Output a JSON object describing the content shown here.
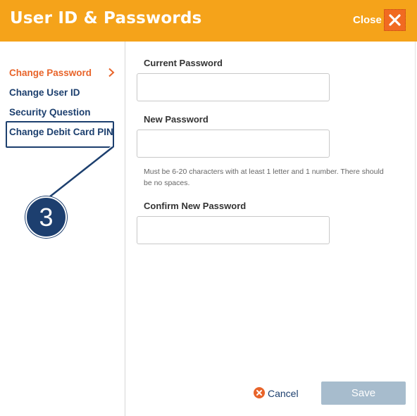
{
  "header": {
    "title": "User ID & Passwords",
    "close_label": "Close",
    "color": "#f5a31a"
  },
  "sidebar": {
    "items": [
      {
        "label": "Change Password",
        "active": true
      },
      {
        "label": "Change User ID",
        "active": false
      },
      {
        "label": "Security Question",
        "active": false
      },
      {
        "label": "Change Debit Card PIN",
        "active": false
      }
    ],
    "active_color": "#e8642a",
    "item_color": "#1c3f6e"
  },
  "callout": {
    "number": "3",
    "target": "Change Debit Card PIN"
  },
  "form": {
    "current_password": {
      "label": "Current Password",
      "value": ""
    },
    "new_password": {
      "label": "New Password",
      "value": ""
    },
    "hint": "Must be 6-20 characters with at least 1 letter and 1 number. There should be no spaces.",
    "confirm_password": {
      "label": "Confirm New Password",
      "value": ""
    }
  },
  "actions": {
    "cancel_label": "Cancel",
    "save_label": "Save",
    "save_color": "#a7bccd"
  },
  "icons": {
    "close": "close-x-icon",
    "chevron": "chevron-right-icon",
    "cancel": "cancel-circle-x-icon"
  }
}
